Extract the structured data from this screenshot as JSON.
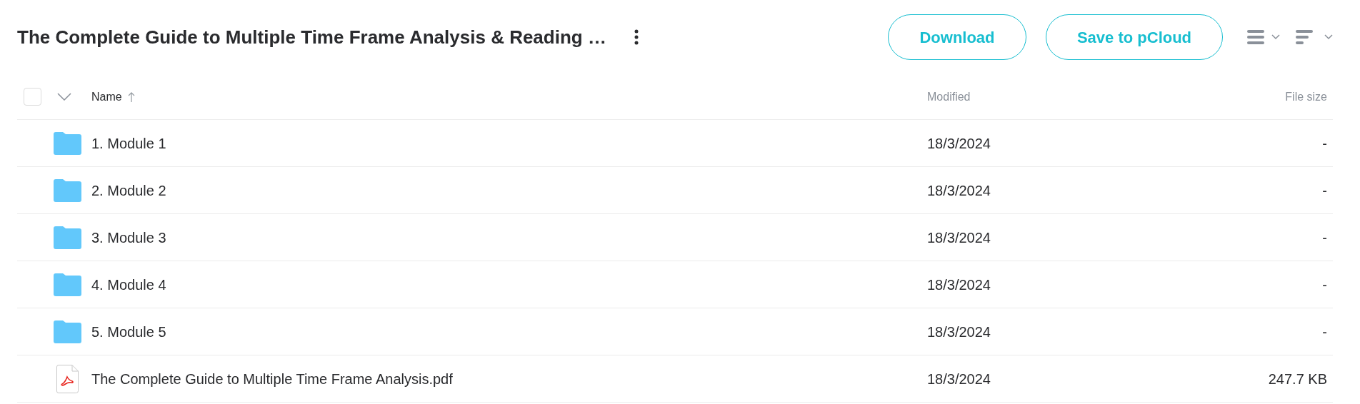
{
  "title": "The Complete Guide to Multiple Time Frame Analysis & Reading …",
  "buttons": [
    "Download",
    "Save to pCloud"
  ],
  "table": {
    "select_all": {
      "checked": false
    },
    "columns": [
      {
        "label": "Name",
        "sorted": true
      },
      {
        "label": "Modified",
        "sorted": false
      },
      {
        "label": "File size",
        "sorted": false
      }
    ],
    "rows": [
      {
        "kind": "folder",
        "name": "1. Module 1",
        "modified": "18/3/2024",
        "size": "-"
      },
      {
        "kind": "folder",
        "name": "2. Module 2",
        "modified": "18/3/2024",
        "size": "-"
      },
      {
        "kind": "folder",
        "name": "3. Module 3",
        "modified": "18/3/2024",
        "size": "-"
      },
      {
        "kind": "folder",
        "name": "4. Module 4",
        "modified": "18/3/2024",
        "size": "-"
      },
      {
        "kind": "folder",
        "name": "5. Module 5",
        "modified": "18/3/2024",
        "size": "-"
      },
      {
        "kind": "pdf",
        "name": "The Complete Guide to Multiple Time Frame Analysis.pdf",
        "modified": "18/3/2024",
        "size": "247.7 KB"
      }
    ]
  }
}
